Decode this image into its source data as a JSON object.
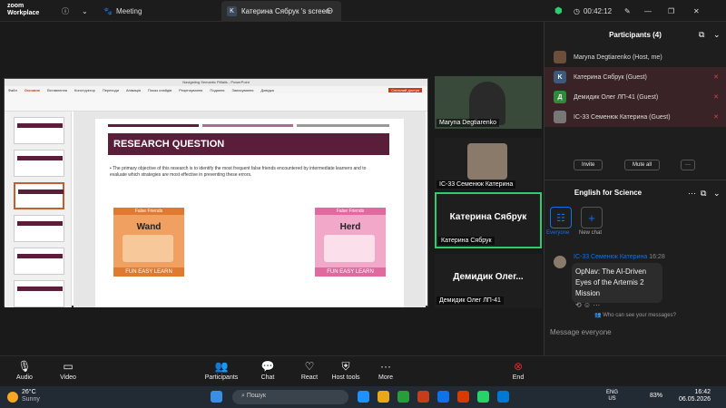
{
  "app": {
    "brand_line1": "zoom",
    "brand_line2": "Workplace"
  },
  "topbar": {
    "meeting_label": "Meeting",
    "screen_tab": "Катерина Сябрук 's screen",
    "tab_badge": "K",
    "timer": "00:42:12"
  },
  "ppt": {
    "title": "Navigating Semantic Pitfalls - PowerPoint",
    "menu": [
      "Файл",
      "Основне",
      "Вставлення",
      "Конструктор",
      "Переходи",
      "Анімація",
      "Показ слайдів",
      "Рецензування",
      "Подання",
      "Записування",
      "Довідка"
    ],
    "share_btn": "Спільний доступ"
  },
  "slide": {
    "heading": "RESEARCH QUESTION",
    "bullet": "The primary objective of this research is to identify the most frequent false friends encountered by intermediate learners and to evaluate which strategies are most effective in preventing these errors.",
    "card1": {
      "header": "False Friends",
      "word": "Wand",
      "footer": "FUN EASY LEARN"
    },
    "card2": {
      "header": "False Friends",
      "word": "Herd",
      "footer": "FUN EASY LEARN"
    }
  },
  "videos": [
    {
      "name": "Maryna Degtiarenko"
    },
    {
      "name": "ІС-33 Семенюк Катерина"
    },
    {
      "name": "Катерина Сябрук",
      "display": "Катерина Сябрук"
    },
    {
      "name": "Демидик Олег ЛП-41",
      "display": "Демидик Олег..."
    }
  ],
  "participants": {
    "title": "Participants (4)",
    "list": [
      {
        "name": "Maryna Degtiarenko (Host, me)",
        "avatar": "",
        "color": "#6b4f3a"
      },
      {
        "name": "Катерина Сябрук (Guest)",
        "avatar": "K",
        "color": "#3d5a7a"
      },
      {
        "name": "Демидик Олег ЛП-41 (Guest)",
        "avatar": "Д",
        "color": "#2e8b3a"
      },
      {
        "name": "ІС-33 Семенюк Катерина (Guest)",
        "avatar": "",
        "color": "#777777"
      }
    ],
    "invite": "Invite",
    "mute_all": "Mute all"
  },
  "chat": {
    "title": "English for Science",
    "everyone": "Everyone",
    "new_chat": "New chat",
    "sender": "ІС-33 Семенюк Катерина",
    "time": "16:28",
    "message": "OpNav: The AI-Driven Eyes of the Artemis 2 Mission",
    "who_can_see": "Who can see your messages?",
    "placeholder": "Message everyone"
  },
  "toolbar": {
    "audio": "Audio",
    "video": "Video",
    "participants": "Participants",
    "participants_count": "4",
    "chat": "Chat",
    "react": "React",
    "host_tools": "Host tools",
    "more": "More",
    "end": "End"
  },
  "taskbar": {
    "weather_temp": "26°C",
    "weather_desc": "Sunny",
    "search": "Пошук",
    "lang1": "ENG",
    "lang2": "US",
    "battery": "83%",
    "time": "16:42",
    "date": "06.05.2026"
  },
  "colors": {
    "accent": "#0e72ed",
    "slide_maroon": "#5b1e3a",
    "end_red": "#e0262b"
  }
}
